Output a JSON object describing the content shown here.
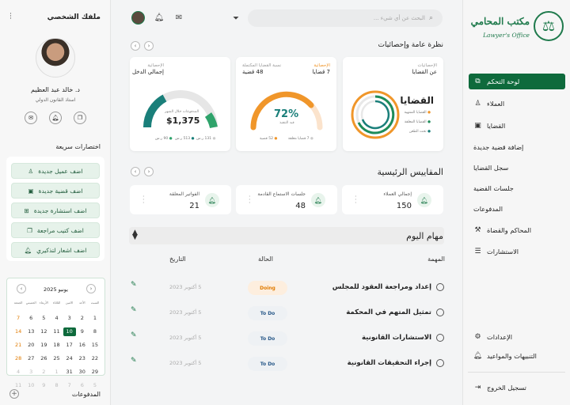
{
  "brand": {
    "name": "مكتب المحامي",
    "tagline": "Lawyer's Office"
  },
  "nav": [
    {
      "label": "لوحة التحكم",
      "icon": "dashboard-icon",
      "active": true
    },
    {
      "label": "العملاء",
      "icon": "user-icon"
    },
    {
      "label": "القضايا",
      "icon": "briefcase-icon"
    },
    {
      "label": "إضافة قضية جديدة",
      "sub": true
    },
    {
      "label": "سجل القضايا",
      "sub": true
    },
    {
      "label": "جلسات القضية",
      "sub": true
    },
    {
      "label": "المدفوعات",
      "sub": true
    },
    {
      "label": "المحاكم والقضاة",
      "icon": "gavel-icon"
    },
    {
      "label": "الاستشارات",
      "icon": "sliders-icon"
    }
  ],
  "nav_bottom": [
    {
      "label": "الإعدادات",
      "icon": "gear-icon"
    },
    {
      "label": "التنبيهات والمواعيد",
      "icon": "bell-icon"
    },
    {
      "label": "تسجيل الخروج",
      "icon": "logout-icon"
    }
  ],
  "search": {
    "placeholder": "البحث عن أي شيء ..."
  },
  "overview": {
    "title": "نظرة عامة وإحصائيات",
    "cases_card": {
      "label": "الإحصائيات",
      "sub": "عن القضايا",
      "title": "القضايا",
      "legend": [
        "القضايا المنتهية",
        "القضايا المعلقة",
        "تحت الطعن"
      ]
    },
    "percent_card": {
      "label": "الإحصائية",
      "value": "7 قضايا",
      "label2": "نسبة القضايا المكتملة",
      "value2": "48 قضية",
      "center": "72%",
      "center_sub": "قيد التنفيذ",
      "legend": [
        "52 قضية",
        "7 قضايا معلقة"
      ]
    },
    "income_card": {
      "label": "الإحصائية",
      "value": "إجمالي الدخل",
      "center_label": "المدفوعات خلال الشهر",
      "center": "$1,375",
      "legend": [
        "131 ر.س",
        "513 ر.س",
        "90 ر.س"
      ]
    }
  },
  "metrics": {
    "title": "المقاييس الرئيسية",
    "items": [
      {
        "label": "إجمالي العملاء",
        "value": "150"
      },
      {
        "label": "جلسات الاستماع القادمة",
        "value": "48"
      },
      {
        "label": "الفواتير المعلقة",
        "value": "21"
      }
    ]
  },
  "tasks": {
    "title": "مهام اليوم",
    "headers": {
      "task": "المهمة",
      "status": "الحالة",
      "date": "التاريخ"
    },
    "rows": [
      {
        "name": "إعداد ومراجعة العقود للمجلس",
        "status": "Doing",
        "date": "5 أكتوبر 2023"
      },
      {
        "name": "تمثيل المتهم في المحكمة",
        "status": "To Do",
        "date": "5 أكتوبر 2023"
      },
      {
        "name": "الاستشارات القانونية",
        "status": "To Do",
        "date": "5 أكتوبر 2023"
      },
      {
        "name": "إجراء التحقيقات القانونية",
        "status": "To Do",
        "date": "5 أكتوبر 2023"
      }
    ]
  },
  "profile": {
    "title": "ملفك الشخصي",
    "name": "د. خالد عبد العظيم",
    "role": "استاذ القانون الدولي"
  },
  "quick": {
    "title": "اختصارات سريعة",
    "items": [
      "اضف عميل جديدة",
      "اضف قضية جديدة",
      "اضف استشارة جديدة",
      "اضف كتيب مراجعة",
      "اضف اشعار لتذكيري"
    ]
  },
  "calendar": {
    "month": "يونيو 2025",
    "weekdays": [
      "السبت",
      "الأحد",
      "الاثنين",
      "الثلاثاء",
      "الأربعاء",
      "الخميس",
      "الجمعة"
    ],
    "days": [
      [
        "1",
        "2",
        "3",
        "4",
        "5",
        "6",
        "7"
      ],
      [
        "8",
        "9",
        "10",
        "11",
        "12",
        "13",
        "14"
      ],
      [
        "15",
        "16",
        "17",
        "18",
        "19",
        "20",
        "21"
      ],
      [
        "22",
        "23",
        "24",
        "25",
        "26",
        "27",
        "28"
      ],
      [
        "29",
        "30",
        "31",
        "1",
        "2",
        "3",
        "4"
      ],
      [
        "5",
        "6",
        "7",
        "8",
        "9",
        "10",
        "11"
      ]
    ]
  },
  "payments_label": "المدفوعات",
  "colors": {
    "primary": "#0e6a3c",
    "orange": "#f0962a",
    "teal": "#1a7f7a"
  }
}
